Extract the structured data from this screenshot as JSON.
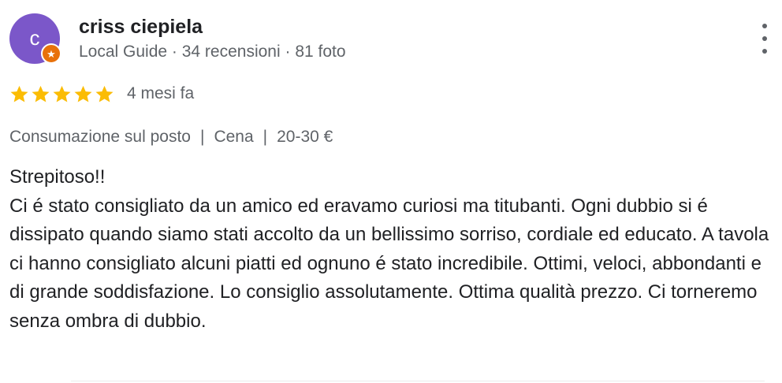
{
  "author": {
    "avatar_letter": "c",
    "avatar_color": "#7b57c9",
    "badge_color": "#e8710a",
    "badge_icon": "star-icon",
    "name": "criss ciepiela",
    "meta": "Local Guide · 34 recensioni · 81 foto"
  },
  "menu": {
    "icon": "more-vert-icon"
  },
  "rating": {
    "stars": 5,
    "max": 5,
    "star_color": "#fbbc04",
    "time": "4 mesi fa"
  },
  "tags": {
    "service": "Consumazione sul posto",
    "meal": "Cena",
    "price": "20-30 €",
    "separator": "|"
  },
  "review": {
    "title": "Strepitoso!!",
    "body": "Ci é stato consigliato da un amico ed eravamo curiosi ma titubanti. Ogni dubbio si é dissipato quando siamo stati accolto da un bellissimo sorriso, cordiale ed educato. A tavola ci hanno consigliato alcuni piatti ed ognuno é stato incredibile. Ottimi, veloci, abbondanti e di grande soddisfazione. Lo consiglio assolutamente. Ottima qualità prezzo. Ci torneremo senza ombra di dubbio."
  }
}
